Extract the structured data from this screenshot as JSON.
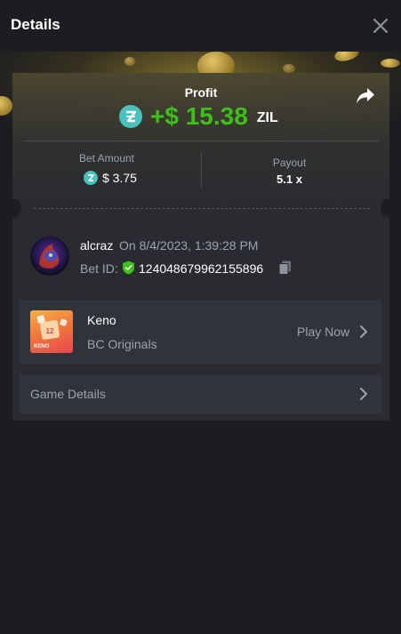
{
  "header": {
    "title": "Details"
  },
  "profit": {
    "label": "Profit",
    "value": "+$ 15.38",
    "currency": "ZIL"
  },
  "bet": {
    "label": "Bet Amount",
    "value": "$ 3.75"
  },
  "payout": {
    "label": "Payout",
    "value": "5.1 x"
  },
  "user": {
    "name": "alcraz",
    "date": "On 8/4/2023, 1:39:28 PM",
    "bet_id_label": "Bet ID:",
    "bet_id": "124048679962155896"
  },
  "game": {
    "name": "Keno",
    "provider": "BC Originals",
    "play_label": "Play Now",
    "thumb_text": "KENO",
    "thumb_number": "12"
  },
  "game_details": {
    "label": "Game Details"
  },
  "colors": {
    "profit_green": "#3bc117",
    "zil_teal": "#49c1bf",
    "background": "#1c1d21",
    "card": "#2a2c32",
    "row": "#31333a",
    "muted_text": "#99a4b0"
  },
  "icons": [
    "close-icon",
    "share-icon",
    "zil-coin-icon",
    "verified-shield-icon",
    "copy-icon",
    "chevron-right-icon"
  ]
}
